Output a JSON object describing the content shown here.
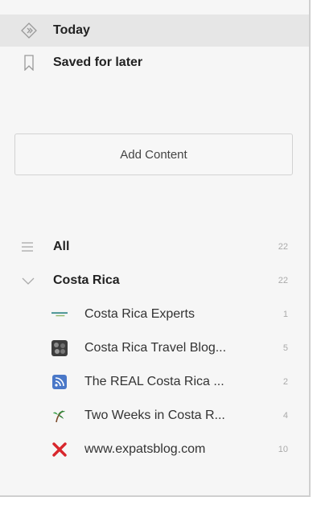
{
  "nav": {
    "today": "Today",
    "saved": "Saved for later"
  },
  "add_content": "Add Content",
  "all": {
    "label": "All",
    "count": "22"
  },
  "category": {
    "label": "Costa Rica",
    "count": "22"
  },
  "feeds": [
    {
      "title": "Costa Rica Experts",
      "count": "1",
      "icon": "costa-rica-experts-logo"
    },
    {
      "title": "Costa Rica Travel Blog...",
      "count": "5",
      "icon": "travel-blog-favicon"
    },
    {
      "title": "The REAL Costa Rica ...",
      "count": "2",
      "icon": "rss-icon"
    },
    {
      "title": "Two Weeks in Costa R...",
      "count": "4",
      "icon": "palm-leaf-icon"
    },
    {
      "title": "www.expatsblog.com",
      "count": "10",
      "icon": "x-logo"
    }
  ],
  "colors": {
    "panel_bg": "#f6f6f6",
    "active_row_bg": "#e6e6e6",
    "rss_blue": "#4a78c8",
    "expats_red": "#d8262c",
    "count_gray": "#aaaaaa"
  }
}
